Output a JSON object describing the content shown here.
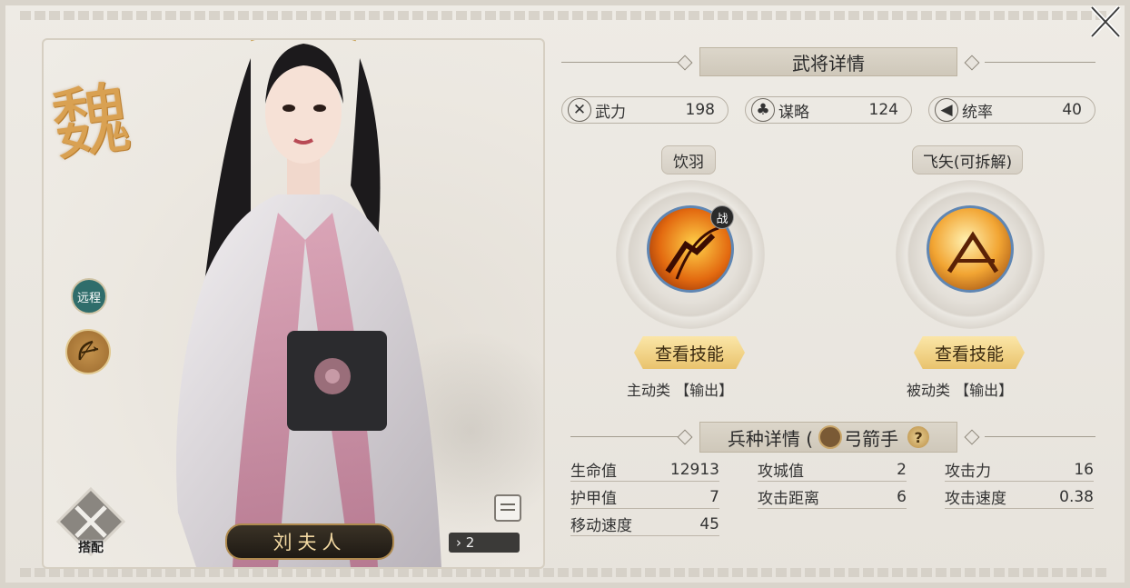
{
  "faction": {
    "char": "魏"
  },
  "hero": {
    "name": "刘夫人",
    "star_count": "2",
    "range_tag": "远程",
    "equip_label": "搭配"
  },
  "details": {
    "title": "武将详情",
    "stats": [
      {
        "label": "武力",
        "value": "198",
        "icon": "swords-icon"
      },
      {
        "label": "谋略",
        "value": "124",
        "icon": "strategy-icon"
      },
      {
        "label": "统率",
        "value": "40",
        "icon": "banner-icon"
      }
    ]
  },
  "skills": [
    {
      "name": "饮羽",
      "button": "查看技能",
      "type": "主动类 【输出】",
      "badge": "战",
      "icon": "archer-skill-icon"
    },
    {
      "name": "飞矢(可拆解)",
      "button": "查看技能",
      "type": "被动类 【输出】",
      "icon": "crossbow-skill-icon"
    }
  ],
  "troop": {
    "title_prefix": "兵种详情 (",
    "type": "弓箭手",
    "help": "?",
    "stats": [
      {
        "label": "生命值",
        "value": "12913"
      },
      {
        "label": "攻城值",
        "value": "2"
      },
      {
        "label": "攻击力",
        "value": "16"
      },
      {
        "label": "护甲值",
        "value": "7"
      },
      {
        "label": "攻击距离",
        "value": "6"
      },
      {
        "label": "攻击速度",
        "value": "0.38"
      },
      {
        "label": "移动速度",
        "value": "45"
      }
    ]
  },
  "colors": {
    "gold": "#e9c36d",
    "faction": "#d9a152",
    "accent_blue": "#5f86b3"
  }
}
